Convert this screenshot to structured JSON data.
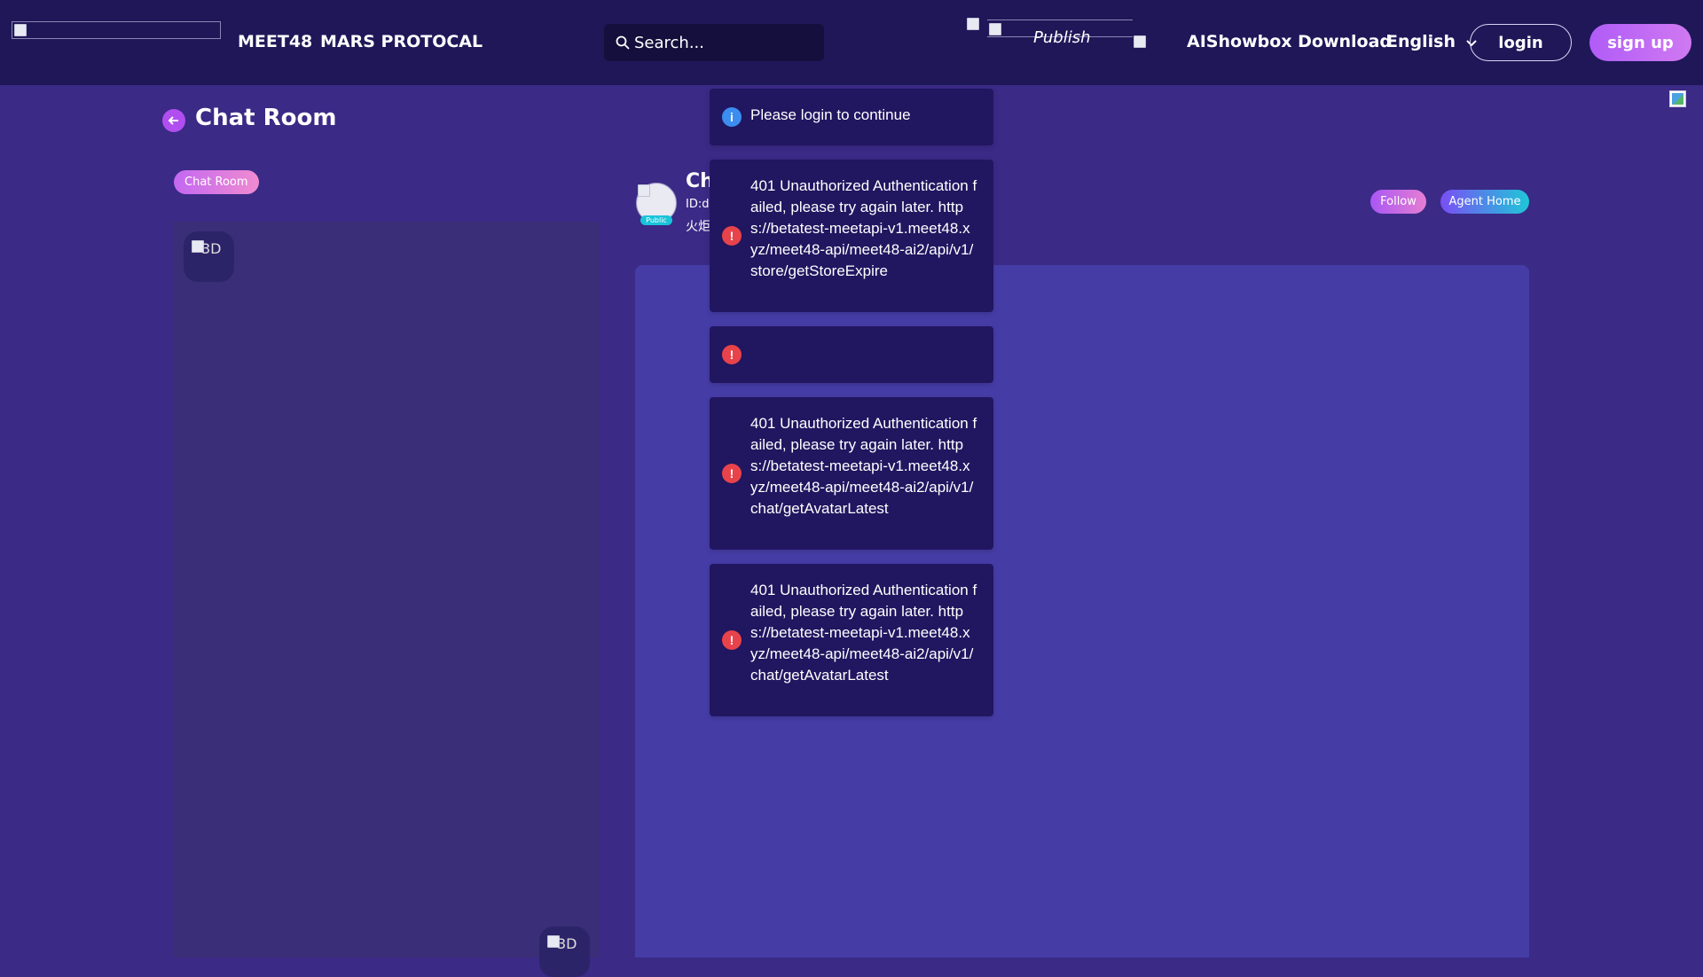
{
  "nav": {
    "brand": "MEET48",
    "protocol": "MARS PROTOCAL",
    "search_placeholder": "Search...",
    "publish": "Publish",
    "download": "AIShowbox Download",
    "language": "English",
    "login": "login",
    "signup": "sign up"
  },
  "page": {
    "title": "Chat Room",
    "chip": "Chat Room"
  },
  "left_panel": {
    "badge_top_alt": "3D",
    "badge_bottom_alt": "3D"
  },
  "agent": {
    "name": "Ch",
    "id_label": "ID:d",
    "desc": "火炬",
    "visibility": "Public",
    "follow": "Follow",
    "agent_home": "Agent Home"
  },
  "toasts": [
    {
      "type": "info",
      "text": "Please login to continue"
    },
    {
      "type": "error",
      "text": "401 Unauthorized Authentication failed, please try again later. https://betatest-meetapi-v1.meet48.xyz/meet48-api/meet48-ai2/api/v1/store/getStoreExpire"
    },
    {
      "type": "error",
      "text": ""
    },
    {
      "type": "error",
      "text": "401 Unauthorized Authentication failed, please try again later. https://betatest-meetapi-v1.meet48.xyz/meet48-api/meet48-ai2/api/v1/chat/getAvatarLatest"
    },
    {
      "type": "error",
      "text": "401 Unauthorized Authentication failed, please try again later. https://betatest-meetapi-v1.meet48.xyz/meet48-api/meet48-ai2/api/v1/chat/getAvatarLatest"
    }
  ],
  "colors": {
    "background": "#3b2a86",
    "topbar": "#1f1758",
    "chat_area": "#463ca6",
    "toast_bg": "#211660",
    "info": "#3b8ef0",
    "error": "#e8434a"
  }
}
